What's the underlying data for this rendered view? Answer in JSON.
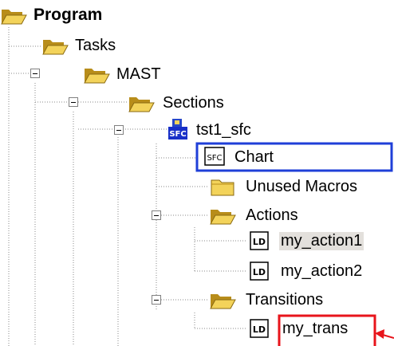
{
  "tree": {
    "root": {
      "label": "Program",
      "icon": "folder-open-icon"
    },
    "tasks": {
      "label": "Tasks",
      "icon": "folder-open-icon"
    },
    "mast": {
      "label": "MAST",
      "icon": "folder-open-icon",
      "expanded": true
    },
    "sections": {
      "label": "Sections",
      "icon": "folder-open-icon",
      "expanded": true
    },
    "tst1_sfc": {
      "label": "tst1_sfc",
      "icon": "sfc-section-icon",
      "badge": "SFC",
      "expanded": true
    },
    "chart": {
      "label": "Chart",
      "icon": "sfc-chart-icon",
      "badge": "SFC",
      "highlight": "#1f3fd8"
    },
    "unused_macros": {
      "label": "Unused Macros",
      "icon": "folder-closed-icon"
    },
    "actions": {
      "label": "Actions",
      "icon": "folder-open-icon",
      "expanded": true
    },
    "my_action1": {
      "label": "my_action1",
      "icon": "ld-icon",
      "badge": "LD",
      "selected": true
    },
    "my_action2": {
      "label": "my_action2",
      "icon": "ld-icon",
      "badge": "LD"
    },
    "transitions": {
      "label": "Transitions",
      "icon": "folder-open-icon",
      "expanded": true
    },
    "my_trans": {
      "label": "my_trans",
      "icon": "ld-icon",
      "badge": "LD",
      "highlight": "#e8141b"
    }
  },
  "colors": {
    "folder": "#f3d35a",
    "folder_dark": "#b88d1a",
    "chart_box": "#1f3fd8",
    "trans_box": "#e8141b",
    "selection": "#e3e0dc"
  }
}
